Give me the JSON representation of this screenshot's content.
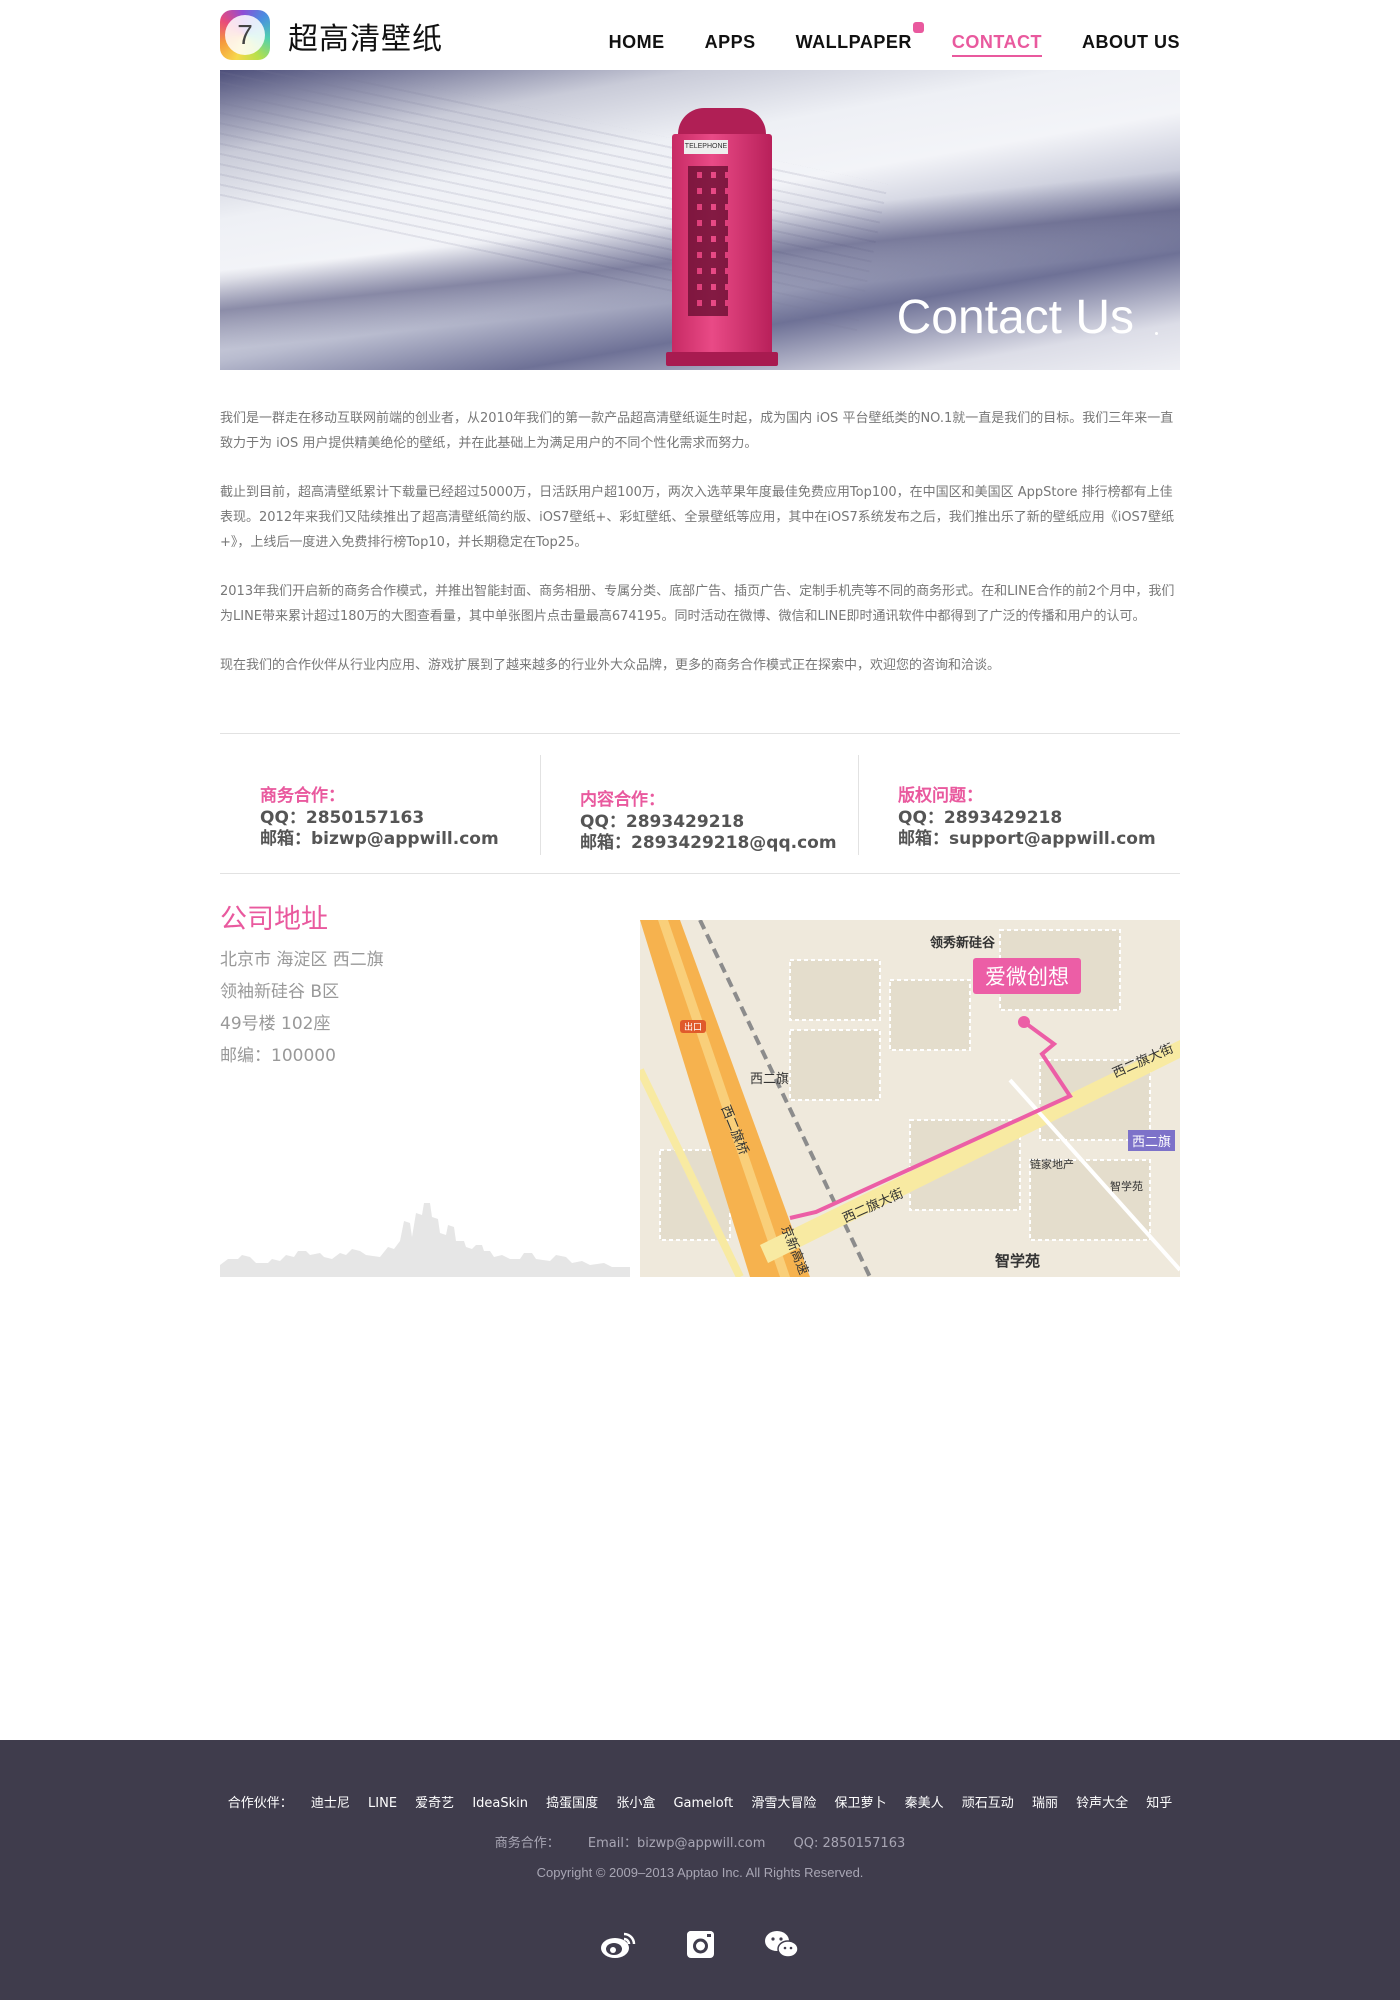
{
  "site": {
    "logo_numeral": "7",
    "logo_text": "超高清壁纸"
  },
  "nav": {
    "items": [
      {
        "label": "HOME",
        "name": "nav-home",
        "active": false
      },
      {
        "label": "APPS",
        "name": "nav-apps",
        "active": false
      },
      {
        "label": "WALLPAPER",
        "name": "nav-wallpaper",
        "active": false,
        "badge": true
      },
      {
        "label": "CONTACT",
        "name": "nav-contact",
        "active": true
      },
      {
        "label": "ABOUT US",
        "name": "nav-about-us",
        "active": false
      }
    ]
  },
  "hero": {
    "caption": "Contact Us",
    "sign": "TELEPHONE"
  },
  "intro": {
    "p1": "我们是一群走在移动互联网前端的创业者，从2010年我们的第一款产品超高清壁纸诞生时起，成为国内 iOS 平台壁纸类的NO.1就一直是我们的目标。我们三年来一直致力于为 iOS 用户提供精美绝伦的壁纸，并在此基础上为满足用户的不同个性化需求而努力。",
    "p2": "截止到目前，超高清壁纸累计下载量已经超过5000万，日活跃用户超100万，两次入选苹果年度最佳免费应用Top100，在中国区和美国区 AppStore 排行榜都有上佳表现。2012年来我们又陆续推出了超高清壁纸简约版、iOS7壁纸+、彩虹壁纸、全景壁纸等应用，其中在iOS7系统发布之后，我们推出乐了新的壁纸应用《iOS7壁纸+》，上线后一度进入免费排行榜Top10，并长期稳定在Top25。",
    "p3": "2013年我们开启新的商务合作模式，并推出智能封面、商务相册、专属分类、底部广告、插页广告、定制手机壳等不同的商务形式。在和LINE合作的前2个月中，我们为LINE带来累计超过180万的大图查看量，其中单张图片点击量最高674195。同时活动在微博、微信和LINE即时通讯软件中都得到了广泛的传播和用户的认可。",
    "p4": "现在我们的合作伙伴从行业内应用、游戏扩展到了越来越多的行业外大众品牌，更多的商务合作模式正在探索中，欢迎您的咨询和洽谈。"
  },
  "contacts": [
    {
      "title": "商务合作：",
      "qq": "QQ：2850157163",
      "email": "邮箱：bizwp@appwill.com"
    },
    {
      "title": "内容合作：",
      "qq": "QQ：2893429218",
      "email": "邮箱：2893429218@qq.com"
    },
    {
      "title": "版权问题：",
      "qq": "QQ：2893429218",
      "email": "邮箱：support@appwill.com"
    }
  ],
  "address": {
    "title": "公司地址",
    "line1": "北京市 海淀区 西二旗",
    "line2": "领袖新硅谷 B区",
    "line3": "49号楼 102座",
    "line4": "邮编：100000"
  },
  "map": {
    "pin": "爱微创想",
    "labels": {
      "area1": "领秀新硅谷",
      "station": "西二旗",
      "road1": "西二旗大街",
      "road2": "西二旗桥",
      "road3": "京新高速",
      "area2": "智学苑",
      "poi1": "链家地产",
      "poi2": "智学苑",
      "badge": "西二旗",
      "exit": "出口"
    }
  },
  "footer": {
    "partners_label": "合作伙伴：",
    "partners": [
      "迪士尼",
      "LINE",
      "爱奇艺",
      "IdeaSkin",
      "捣蛋国度",
      "张小盒",
      "Gameloft",
      "滑雪大冒险",
      "保卫萝卜",
      "秦美人",
      "顽石互动",
      "瑞丽",
      "铃声大全",
      "知乎"
    ],
    "biz_label": "商务合作：",
    "biz_email": "Email：bizwp@appwill.com",
    "biz_qq": "QQ: 2850157163",
    "copyright": "Copyright © 2009–2013 Apptao Inc. All Rights Reserved.",
    "social": [
      "weibo-icon",
      "instagram-icon",
      "wechat-icon"
    ]
  },
  "colors": {
    "accent": "#e9599e",
    "footer_bg": "#3f3c4c"
  }
}
